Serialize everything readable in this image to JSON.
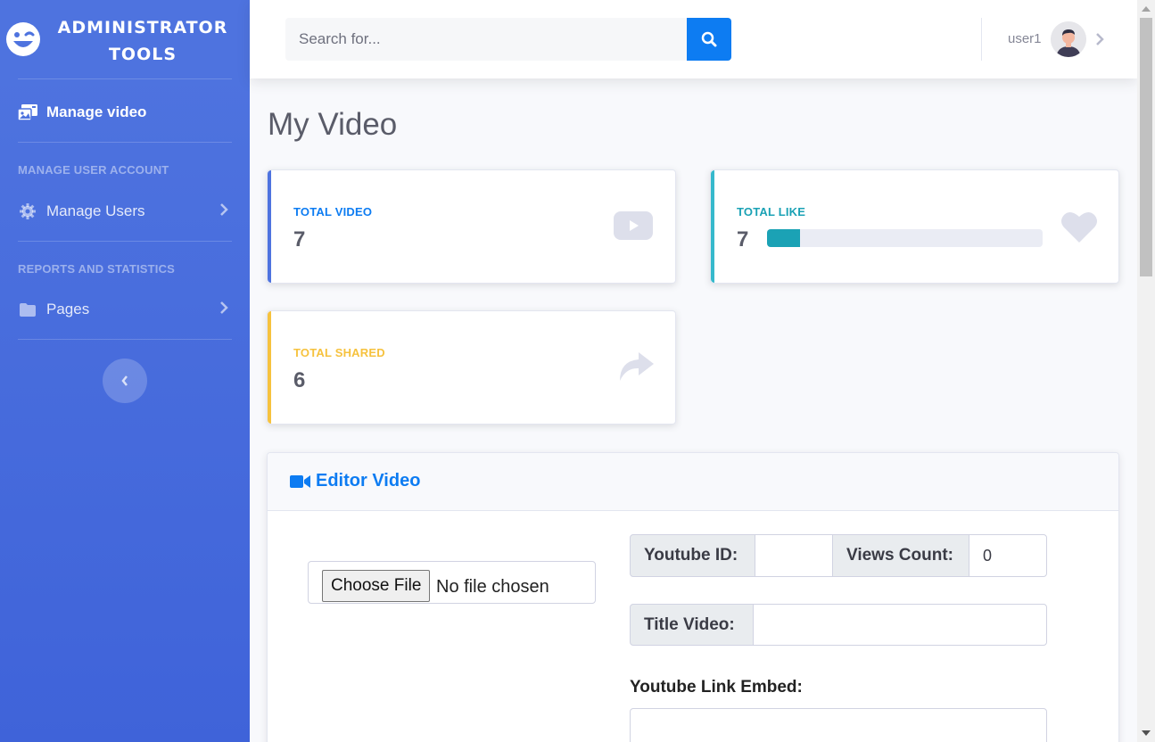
{
  "brand": {
    "line1": "ADMINISTRATOR",
    "line2": "TOOLS",
    "icon": "smiley-wink-icon"
  },
  "sidebar": {
    "active_item": {
      "label": "Manage video",
      "icon": "photo-video-icon"
    },
    "sections": [
      {
        "heading": "MANAGE USER ACCOUNT",
        "item": {
          "label": "Manage Users",
          "icon": "gear-icon"
        }
      },
      {
        "heading": "REPORTS AND STATISTICS",
        "item": {
          "label": "Pages",
          "icon": "folder-icon"
        }
      }
    ],
    "toggle_icon": "chevron-left-icon"
  },
  "topbar": {
    "search_placeholder": "Search for...",
    "search_icon": "search-icon",
    "username": "user1",
    "avatar_icon": "user-avatar-icon"
  },
  "page": {
    "title": "My Video"
  },
  "stats": {
    "video": {
      "label": "TOTAL VIDEO",
      "value": "7",
      "color": "#0d7cf2",
      "bar_color": "#4e73df",
      "icon": "youtube-play-icon"
    },
    "like": {
      "label": "TOTAL LIKE",
      "value": "7",
      "color": "#1ba2b5",
      "bar_color": "#36b9cc",
      "icon": "heart-icon",
      "progress_percent": 12
    },
    "shared": {
      "label": "TOTAL SHARED",
      "value": "6",
      "color": "#f6c23e",
      "bar_color": "#f6c23e",
      "icon": "share-arrow-icon"
    }
  },
  "editor": {
    "title": "Editor Video",
    "title_icon": "video-camera-icon",
    "file_button": "Choose File",
    "file_status": "No file chosen",
    "youtube_id_label": "Youtube ID:",
    "youtube_id_value": "",
    "views_label": "Views Count:",
    "views_value": "0",
    "title_label": "Title Video:",
    "title_value": "",
    "embed_label": "Youtube Link Embed:",
    "embed_value": ""
  }
}
